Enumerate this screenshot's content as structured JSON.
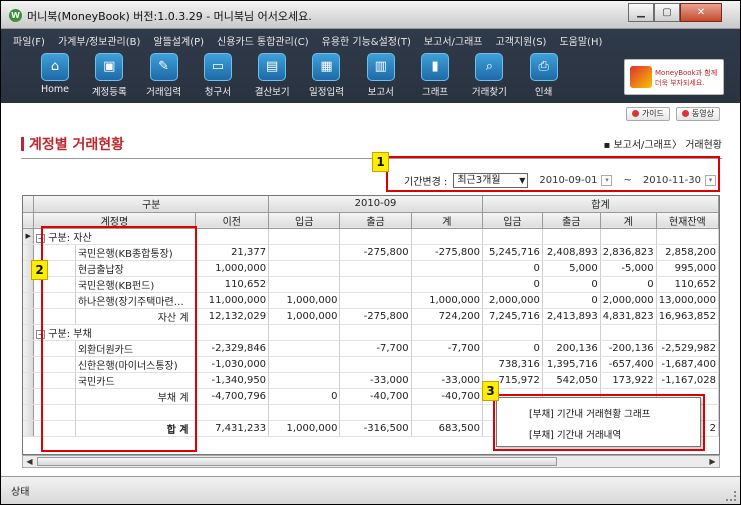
{
  "window": {
    "title": "머니북(MoneyBook) 버전:1.0.3.29 - 머니북님 어서오세요.",
    "app_icon": "W",
    "minimize": "▁",
    "maximize": "▢",
    "close": "✕"
  },
  "menu": [
    "파일(F)",
    "가계부/정보관리(B)",
    "알뜰설계(P)",
    "신용카드 통합관리(C)",
    "유용한 기능&설정(T)",
    "보고서/그래프",
    "고객지원(S)",
    "도움말(H)"
  ],
  "toolbar": [
    {
      "label": "Home",
      "icon": "home-icon",
      "glyph": "⌂"
    },
    {
      "label": "계정등록",
      "icon": "account-register-icon",
      "glyph": "▣"
    },
    {
      "label": "거래입력",
      "icon": "transaction-input-icon",
      "glyph": "✎"
    },
    {
      "label": "청구서",
      "icon": "bill-card-icon",
      "glyph": "▭"
    },
    {
      "label": "결산보기",
      "icon": "monitor-icon",
      "glyph": "▤"
    },
    {
      "label": "일정입력",
      "icon": "calendar-icon",
      "glyph": "▦"
    },
    {
      "label": "보고서",
      "icon": "report-icon",
      "glyph": "▥"
    },
    {
      "label": "그래프",
      "icon": "bar-chart-icon",
      "glyph": "▮"
    },
    {
      "label": "거래찾기",
      "icon": "search-icon",
      "glyph": "⌕"
    },
    {
      "label": "인쇄",
      "icon": "printer-icon",
      "glyph": "⎙"
    }
  ],
  "brand": {
    "line1": "MoneyBook과 함께",
    "line2": "더욱 부자되세요."
  },
  "help": {
    "guide": "가이드",
    "video": "동영상"
  },
  "page": {
    "title": "계정별 거래현황",
    "breadcrumb": "▪ 보고서/그래프〉 거래현황"
  },
  "period": {
    "label": "기간변경 :",
    "selected": "최근3개월",
    "start": "2010-09-01",
    "separator": "~",
    "end": "2010-11-30"
  },
  "grid": {
    "group_headers": {
      "category": "구분",
      "month": "2010-09",
      "sum": "합계"
    },
    "columns": [
      "계정명",
      "이전",
      "입금",
      "출금",
      "계",
      "입금",
      "출금",
      "계",
      "현재잔액"
    ],
    "groups": [
      {
        "label": "구분: 자산",
        "rows": [
          [
            "국민은행(KB종합통장)",
            "21,377",
            "",
            "-275,800",
            "-275,800",
            "5,245,716",
            "2,408,893",
            "2,836,823",
            "2,858,200"
          ],
          [
            "현금출납장",
            "1,000,000",
            "",
            "",
            "",
            "0",
            "5,000",
            "-5,000",
            "995,000"
          ],
          [
            "국민은행(KB펀드)",
            "110,652",
            "",
            "",
            "",
            "0",
            "0",
            "0",
            "110,652"
          ],
          [
            "하나은행(장기주택마련…",
            "11,000,000",
            "1,000,000",
            "",
            "1,000,000",
            "2,000,000",
            "0",
            "2,000,000",
            "13,000,000"
          ]
        ],
        "subtotal": [
          "자산 계",
          "12,132,029",
          "1,000,000",
          "-275,800",
          "724,200",
          "7,245,716",
          "2,413,893",
          "4,831,823",
          "16,963,852"
        ]
      },
      {
        "label": "구분: 부채",
        "rows": [
          [
            "외환더원카드",
            "-2,329,846",
            "",
            "-7,700",
            "-7,700",
            "0",
            "200,136",
            "-200,136",
            "-2,529,982"
          ],
          [
            "신한은행(마이너스통장)",
            "-1,030,000",
            "",
            "",
            "",
            "738,316",
            "1,395,716",
            "-657,400",
            "-1,687,400"
          ],
          [
            "국민카드",
            "-1,340,950",
            "",
            "-33,000",
            "-33,000",
            "715,972",
            "542,050",
            "173,922",
            "-1,167,028"
          ]
        ],
        "subtotal": [
          "부채 계",
          "-4,700,796",
          "0",
          "-40,700",
          "-40,700",
          "",
          "",
          "",
          ""
        ]
      }
    ],
    "total": [
      "합 계",
      "7,431,233",
      "1,000,000",
      "-316,500",
      "683,500",
      "8,",
      "",
      "",
      "2"
    ]
  },
  "context_menu": [
    "[부채] 기간내 거래현황 그래프",
    "[부채] 기간내 거래내역"
  ],
  "callouts": [
    "1",
    "2",
    "3"
  ],
  "status": "상태",
  "colors": {
    "accent_red": "#c0262c",
    "callout_red": "#e00000",
    "badge_yellow": "#ffee00",
    "appbar": "#2f3a4a"
  }
}
